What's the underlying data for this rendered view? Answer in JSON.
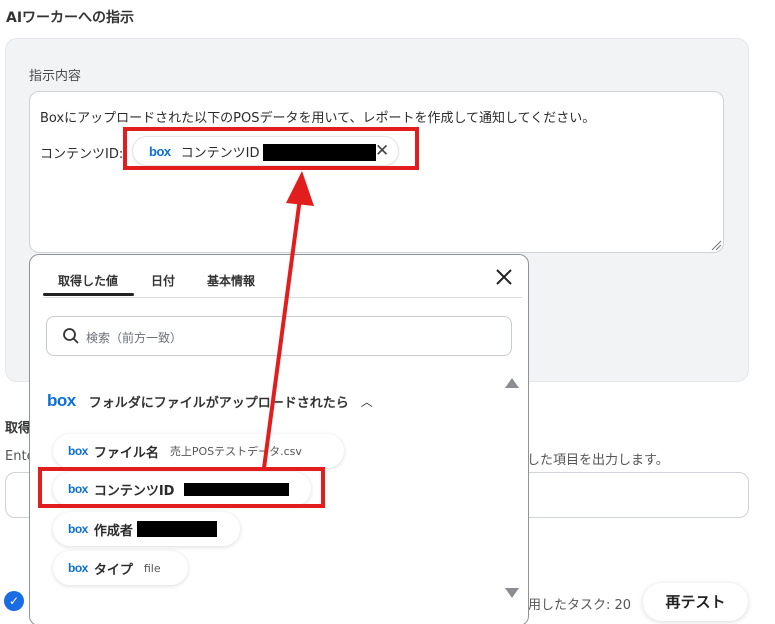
{
  "section": {
    "title": "AIワーカーへの指示"
  },
  "instruction": {
    "label": "指示内容",
    "line1": "Boxにアップロードされた以下のPOSデータを用いて、レポートを作成して通知してください。",
    "line2_prefix": "コンテンツID:",
    "token": {
      "logo": "box",
      "label": "コンテンツID",
      "remove_icon": "close-icon"
    }
  },
  "background": {
    "label": "取得",
    "desc_start": "Ente",
    "desc_end": "した項目を出力します。",
    "task_count": "用したタスク: 20",
    "retest_button": "再テスト"
  },
  "dropdown": {
    "tabs": [
      "取得した値",
      "日付",
      "基本情報"
    ],
    "active_tab": 0,
    "search_placeholder": "検索（前方一致）",
    "group": {
      "logo": "box",
      "title": "フォルダにファイルがアップロードされたら",
      "expanded": true
    },
    "items": [
      {
        "logo": "box",
        "name": "ファイル名",
        "value": "売上POSテストデータ.csv",
        "redacted": false
      },
      {
        "logo": "box",
        "name": "コンテンツID",
        "value": "",
        "redacted": true
      },
      {
        "logo": "box",
        "name": "作成者",
        "value": "",
        "redacted": true
      },
      {
        "logo": "box",
        "name": "タイプ",
        "value": "file",
        "redacted": false
      }
    ]
  },
  "colors": {
    "highlight": "#e21d1d",
    "box_brand": "#0a6fd8",
    "check": "#1a6ce2"
  }
}
